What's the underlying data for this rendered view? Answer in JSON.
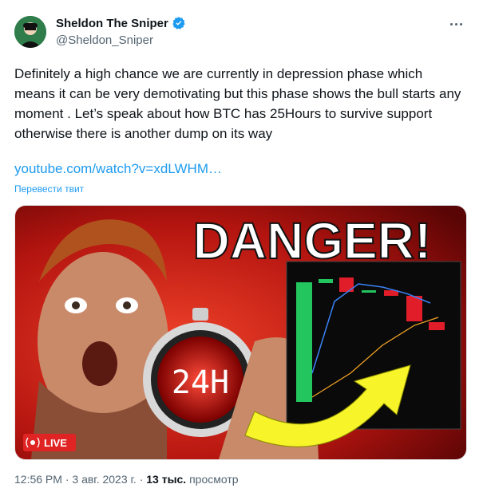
{
  "author": {
    "display_name": "Sheldon The Sniper",
    "handle": "@Sheldon_Sniper",
    "verified": true
  },
  "tweet": {
    "text": "Definitely a high chance we are currently in depression phase which means it can be very demotivating but this phase shows the bull starts any moment . Let’s speak about how BTC has 25Hours to survive support otherwise there is another dump on its way",
    "link": "youtube.com/watch?v=xdLWHM…",
    "translate_label": "Перевести твит"
  },
  "thumbnail": {
    "headline": "DANGER!",
    "timer_text": "24H",
    "live_label": "LIVE"
  },
  "meta": {
    "time": "12:56 PM",
    "separator": "·",
    "date": "3 авг. 2023 г.",
    "views_count": "13 тыс.",
    "views_label": "просмотр"
  },
  "colors": {
    "link": "#1d9bf0",
    "secondary_text": "#536471",
    "live_badge": "#e02424",
    "candle_green": "#22c55e",
    "candle_red": "#e11d2a",
    "arrow_yellow": "#f7f52a"
  }
}
